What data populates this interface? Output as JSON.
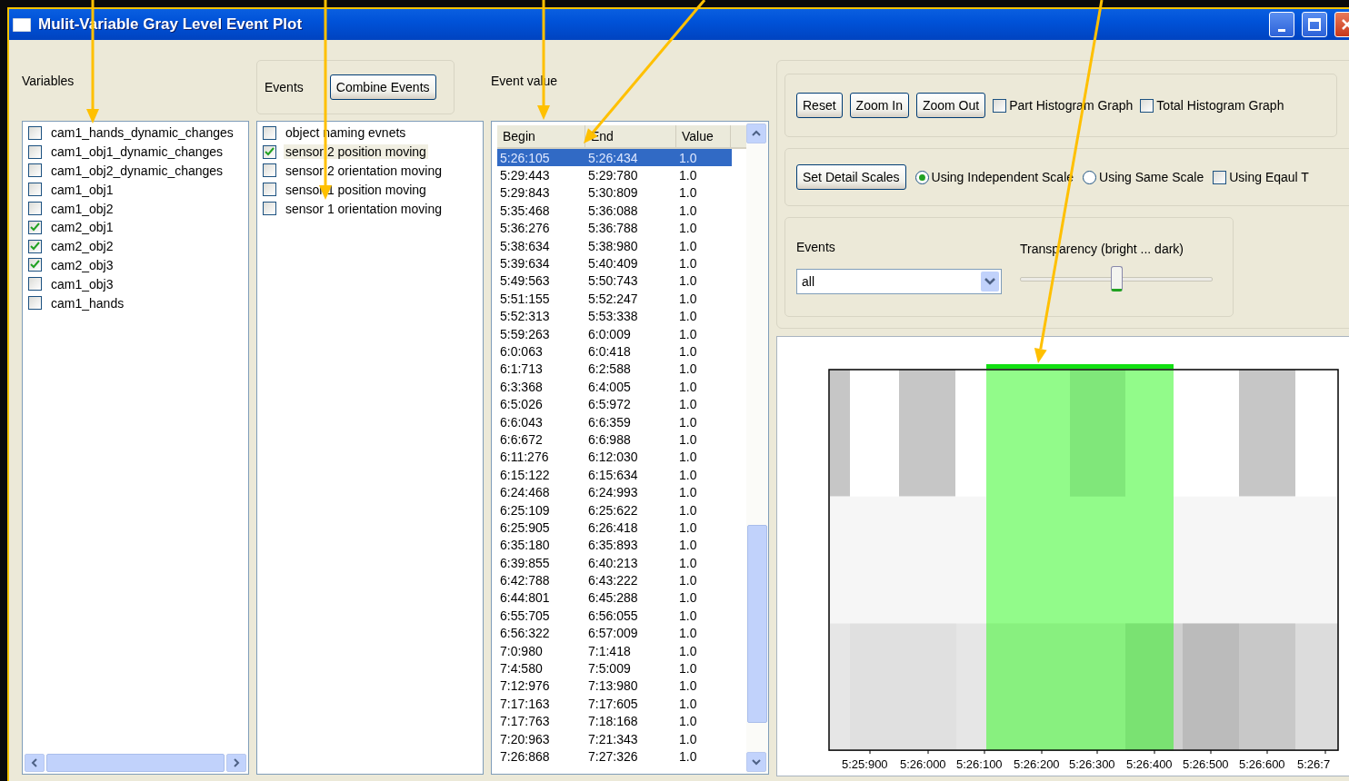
{
  "window": {
    "title": "Mulit-Variable Gray Level Event Plot"
  },
  "variables": {
    "label": "Variables",
    "items": [
      {
        "label": "cam1_hands_dynamic_changes",
        "checked": false
      },
      {
        "label": "cam1_obj1_dynamic_changes",
        "checked": false
      },
      {
        "label": "cam1_obj2_dynamic_changes",
        "checked": false
      },
      {
        "label": "cam1_obj1",
        "checked": false
      },
      {
        "label": "cam1_obj2",
        "checked": false
      },
      {
        "label": "cam2_obj1",
        "checked": true
      },
      {
        "label": "cam2_obj2",
        "checked": true
      },
      {
        "label": "cam2_obj3",
        "checked": true
      },
      {
        "label": "cam1_obj3",
        "checked": false
      },
      {
        "label": "cam1_hands",
        "checked": false
      }
    ]
  },
  "events": {
    "label": "Events",
    "combine_button": "Combine Events",
    "items": [
      {
        "label": "object naming evnets",
        "checked": false,
        "selected": false
      },
      {
        "label": "sensor 2 position moving",
        "checked": true,
        "selected": true
      },
      {
        "label": "sensor 2 orientation moving",
        "checked": false,
        "selected": false
      },
      {
        "label": "sensor 1 position moving",
        "checked": false,
        "selected": false
      },
      {
        "label": "sensor 1 orientation moving",
        "checked": false,
        "selected": false
      }
    ]
  },
  "event_value": {
    "label": "Event value",
    "columns": [
      "Begin",
      "End",
      "Value"
    ],
    "rows": [
      {
        "cells": [
          "5:26:105",
          "5:26:434",
          "1.0"
        ],
        "selected": true
      },
      {
        "cells": [
          "5:29:443",
          "5:29:780",
          "1.0"
        ],
        "selected": false
      },
      {
        "cells": [
          "5:29:843",
          "5:30:809",
          "1.0"
        ],
        "selected": false
      },
      {
        "cells": [
          "5:35:468",
          "5:36:088",
          "1.0"
        ],
        "selected": false
      },
      {
        "cells": [
          "5:36:276",
          "5:36:788",
          "1.0"
        ],
        "selected": false
      },
      {
        "cells": [
          "5:38:634",
          "5:38:980",
          "1.0"
        ],
        "selected": false
      },
      {
        "cells": [
          "5:39:634",
          "5:40:409",
          "1.0"
        ],
        "selected": false
      },
      {
        "cells": [
          "5:49:563",
          "5:50:743",
          "1.0"
        ],
        "selected": false
      },
      {
        "cells": [
          "5:51:155",
          "5:52:247",
          "1.0"
        ],
        "selected": false
      },
      {
        "cells": [
          "5:52:313",
          "5:53:338",
          "1.0"
        ],
        "selected": false
      },
      {
        "cells": [
          "5:59:263",
          "6:0:009",
          "1.0"
        ],
        "selected": false
      },
      {
        "cells": [
          "6:0:063",
          "6:0:418",
          "1.0"
        ],
        "selected": false
      },
      {
        "cells": [
          "6:1:713",
          "6:2:588",
          "1.0"
        ],
        "selected": false
      },
      {
        "cells": [
          "6:3:368",
          "6:4:005",
          "1.0"
        ],
        "selected": false
      },
      {
        "cells": [
          "6:5:026",
          "6:5:972",
          "1.0"
        ],
        "selected": false
      },
      {
        "cells": [
          "6:6:043",
          "6:6:359",
          "1.0"
        ],
        "selected": false
      },
      {
        "cells": [
          "6:6:672",
          "6:6:988",
          "1.0"
        ],
        "selected": false
      },
      {
        "cells": [
          "6:11:276",
          "6:12:030",
          "1.0"
        ],
        "selected": false
      },
      {
        "cells": [
          "6:15:122",
          "6:15:634",
          "1.0"
        ],
        "selected": false
      },
      {
        "cells": [
          "6:24:468",
          "6:24:993",
          "1.0"
        ],
        "selected": false
      },
      {
        "cells": [
          "6:25:109",
          "6:25:622",
          "1.0"
        ],
        "selected": false
      },
      {
        "cells": [
          "6:25:905",
          "6:26:418",
          "1.0"
        ],
        "selected": false
      },
      {
        "cells": [
          "6:35:180",
          "6:35:893",
          "1.0"
        ],
        "selected": false
      },
      {
        "cells": [
          "6:39:855",
          "6:40:213",
          "1.0"
        ],
        "selected": false
      },
      {
        "cells": [
          "6:42:788",
          "6:43:222",
          "1.0"
        ],
        "selected": false
      },
      {
        "cells": [
          "6:44:801",
          "6:45:288",
          "1.0"
        ],
        "selected": false
      },
      {
        "cells": [
          "6:55:705",
          "6:56:055",
          "1.0"
        ],
        "selected": false
      },
      {
        "cells": [
          "6:56:322",
          "6:57:009",
          "1.0"
        ],
        "selected": false
      },
      {
        "cells": [
          "7:0:980",
          "7:1:418",
          "1.0"
        ],
        "selected": false
      },
      {
        "cells": [
          "7:4:580",
          "7:5:009",
          "1.0"
        ],
        "selected": false
      },
      {
        "cells": [
          "7:12:976",
          "7:13:980",
          "1.0"
        ],
        "selected": false
      },
      {
        "cells": [
          "7:17:163",
          "7:17:605",
          "1.0"
        ],
        "selected": false
      },
      {
        "cells": [
          "7:17:763",
          "7:18:168",
          "1.0"
        ],
        "selected": false
      },
      {
        "cells": [
          "7:20:963",
          "7:21:343",
          "1.0"
        ],
        "selected": false
      },
      {
        "cells": [
          "7:26:868",
          "7:27:326",
          "1.0"
        ],
        "selected": false
      }
    ]
  },
  "controls": {
    "buttons": [
      "Reset",
      "Zoom In",
      "Zoom Out"
    ],
    "options": [
      {
        "kind": "checkbox",
        "label": "Part Histogram Graph",
        "checked": false
      },
      {
        "kind": "checkbox",
        "label": "Total Histogram Graph",
        "checked": false
      }
    ]
  },
  "scales": {
    "button": "Set Detail Scales",
    "options": [
      {
        "kind": "radio",
        "label": "Using Independent Scale",
        "selected": true
      },
      {
        "kind": "radio",
        "label": "Using Same Scale",
        "selected": false
      },
      {
        "kind": "checkbox",
        "label": "Using Eqaul T",
        "checked": false
      }
    ]
  },
  "filter": {
    "events_label": "Events",
    "events_value": "all",
    "transparency_label": "Transparency (bright ... dark)",
    "transparency": {
      "level": 0.5
    }
  },
  "plot": {
    "x_tick_labels": [
      "5:25:900",
      "5:26:000",
      "5:26:100",
      "5:26:200",
      "5:26:300",
      "5:26:400",
      "5:26:500",
      "5:26:600",
      "5:26:7"
    ]
  }
}
